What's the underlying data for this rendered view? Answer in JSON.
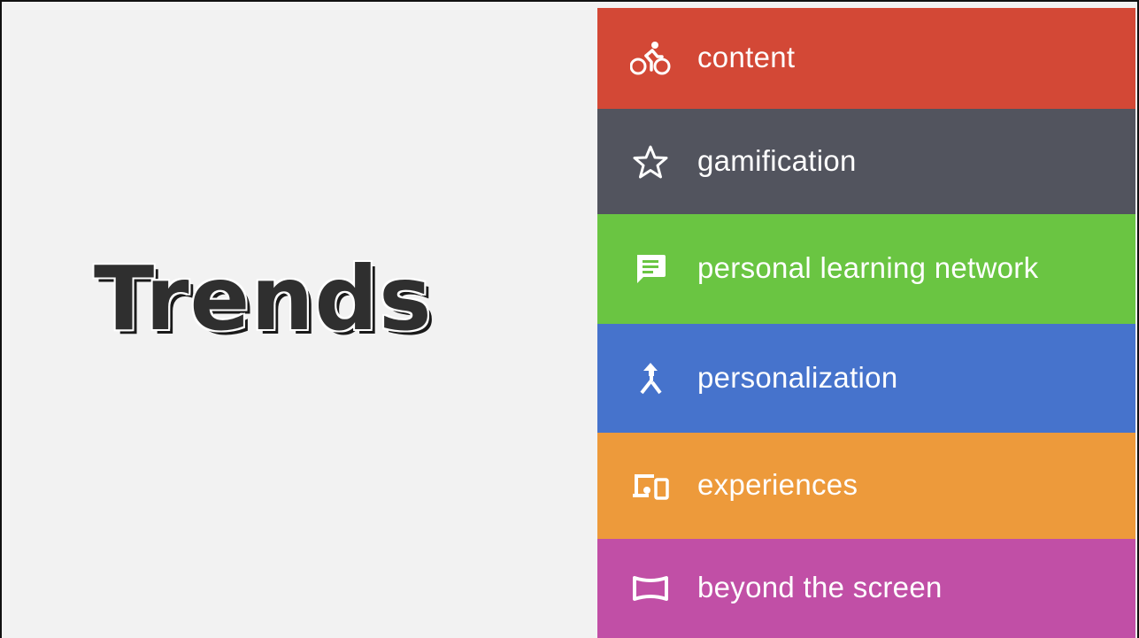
{
  "slide": {
    "title": "Trends",
    "background": "#f2f2f2"
  },
  "menu": {
    "items": [
      {
        "label": "content",
        "icon": "bicycle-icon",
        "color": "#d34836"
      },
      {
        "label": "gamification",
        "icon": "star-outline-icon",
        "color": "#52545e"
      },
      {
        "label": "personal learning network",
        "icon": "chat-bubble-icon",
        "color": "#6ac542"
      },
      {
        "label": "personalization",
        "icon": "merge-arrow-icon",
        "color": "#4673cc"
      },
      {
        "label": "experiences",
        "icon": "devices-icon",
        "color": "#ed9a3b"
      },
      {
        "label": "beyond the screen",
        "icon": "panorama-icon",
        "color": "#c14fa6"
      }
    ]
  }
}
